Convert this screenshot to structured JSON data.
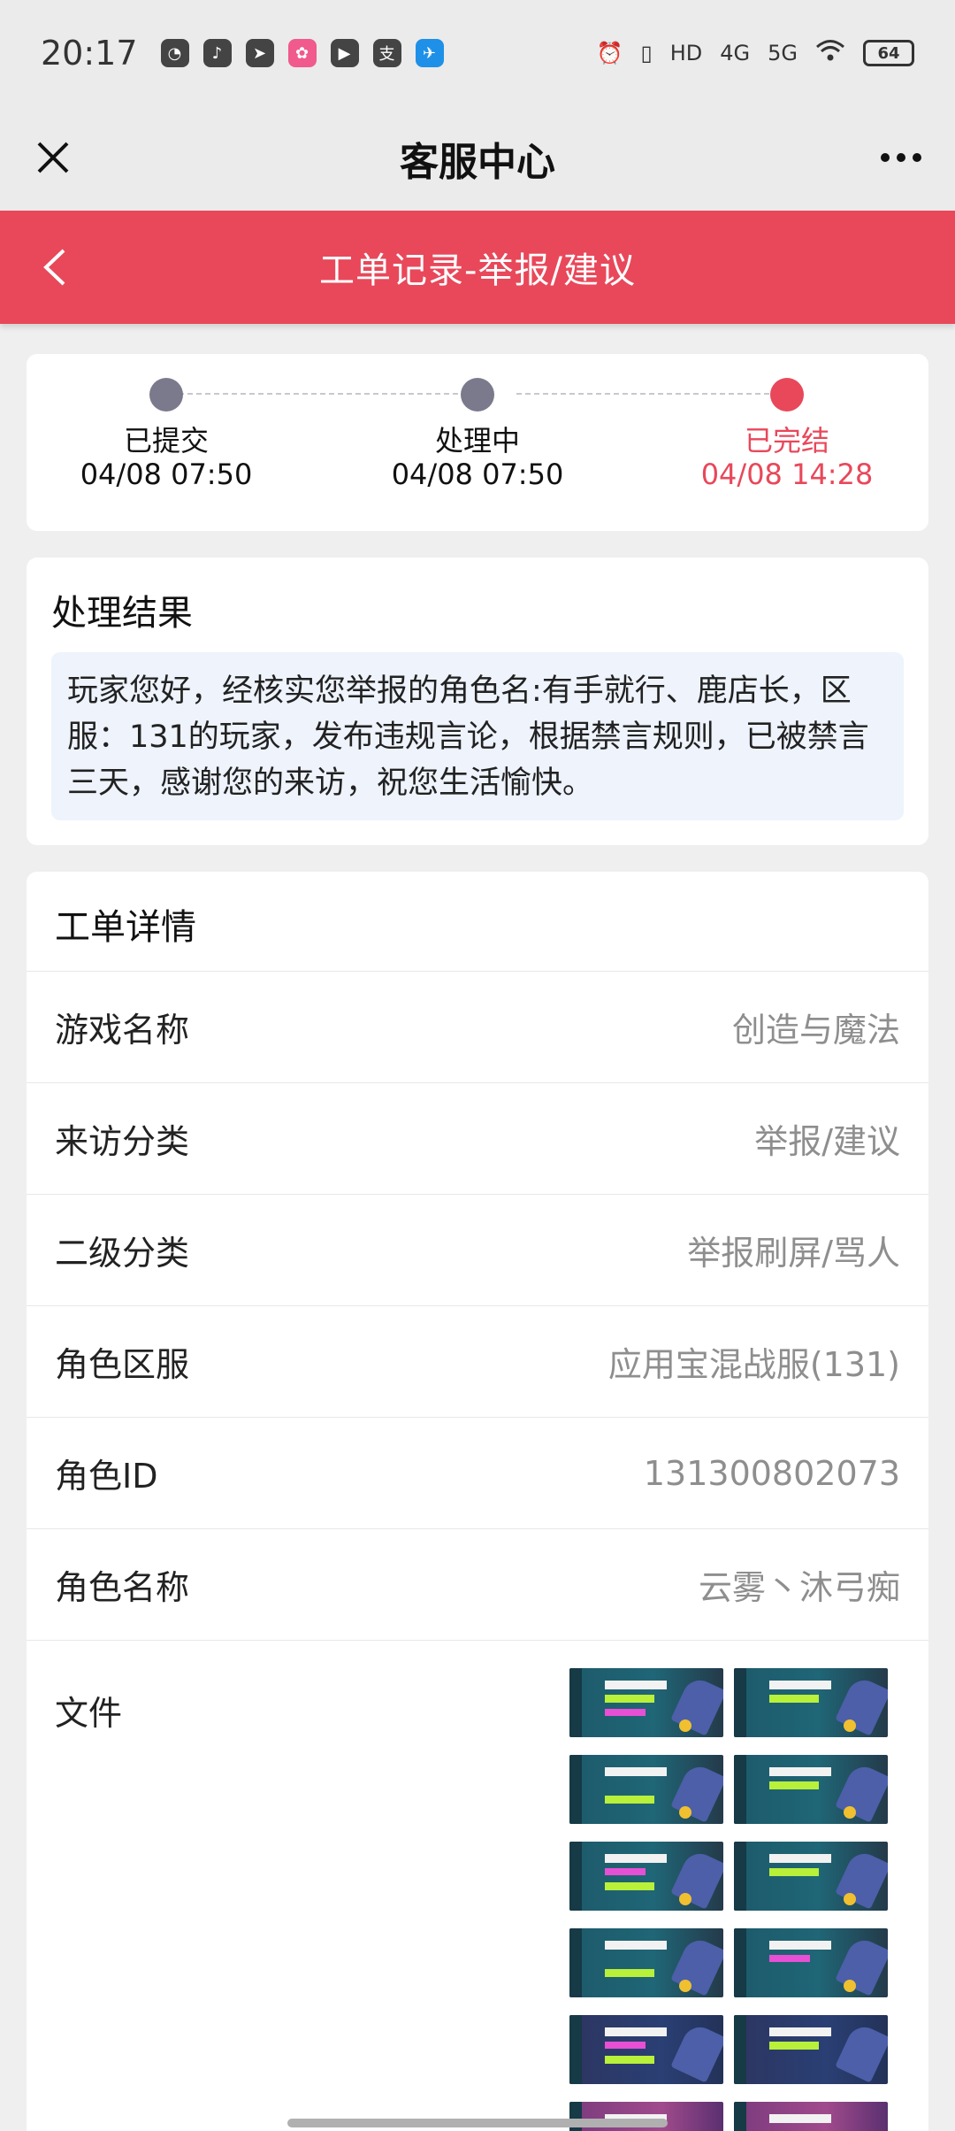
{
  "status_bar": {
    "time": "20:17",
    "battery": "64",
    "icons": [
      "clock-app-icon",
      "tiktok-icon",
      "telegram-icon",
      "lofter-icon",
      "video-player-icon",
      "alipay-icon",
      "feishu-icon",
      "alarm-icon",
      "vibrate-icon",
      "hd-icon",
      "signal-4g-icon",
      "signal-5g-icon",
      "wifi-icon",
      "battery-icon"
    ],
    "network_labels": {
      "hd": "HD",
      "g4": "4G",
      "g5": "5G"
    }
  },
  "nav": {
    "title": "客服中心"
  },
  "header": {
    "title": "工单记录-举报/建议",
    "accent_color": "#e8485a"
  },
  "progress": {
    "steps": [
      {
        "label": "已提交",
        "time": "04/08 07:50"
      },
      {
        "label": "处理中",
        "time": "04/08 07:50"
      },
      {
        "label": "已完结",
        "time": "04/08 14:28"
      }
    ]
  },
  "result": {
    "title": "处理结果",
    "text": "玩家您好，经核实您举报的角色名:有手就行、鹿店长，区服：131的玩家，发布违规言论，根据禁言规则，已被禁言三天，感谢您的来访，祝您生活愉快。"
  },
  "detail": {
    "title": "工单详情",
    "rows": [
      {
        "key": "游戏名称",
        "value": "创造与魔法"
      },
      {
        "key": "来访分类",
        "value": "举报/建议"
      },
      {
        "key": "二级分类",
        "value": "举报刷屏/骂人"
      },
      {
        "key": "角色区服",
        "value": "应用宝混战服(131)"
      },
      {
        "key": "角色ID",
        "value": "131300802073"
      },
      {
        "key": "角色名称",
        "value": "云雾丶沐弓痴"
      }
    ],
    "files_label": "文件"
  }
}
